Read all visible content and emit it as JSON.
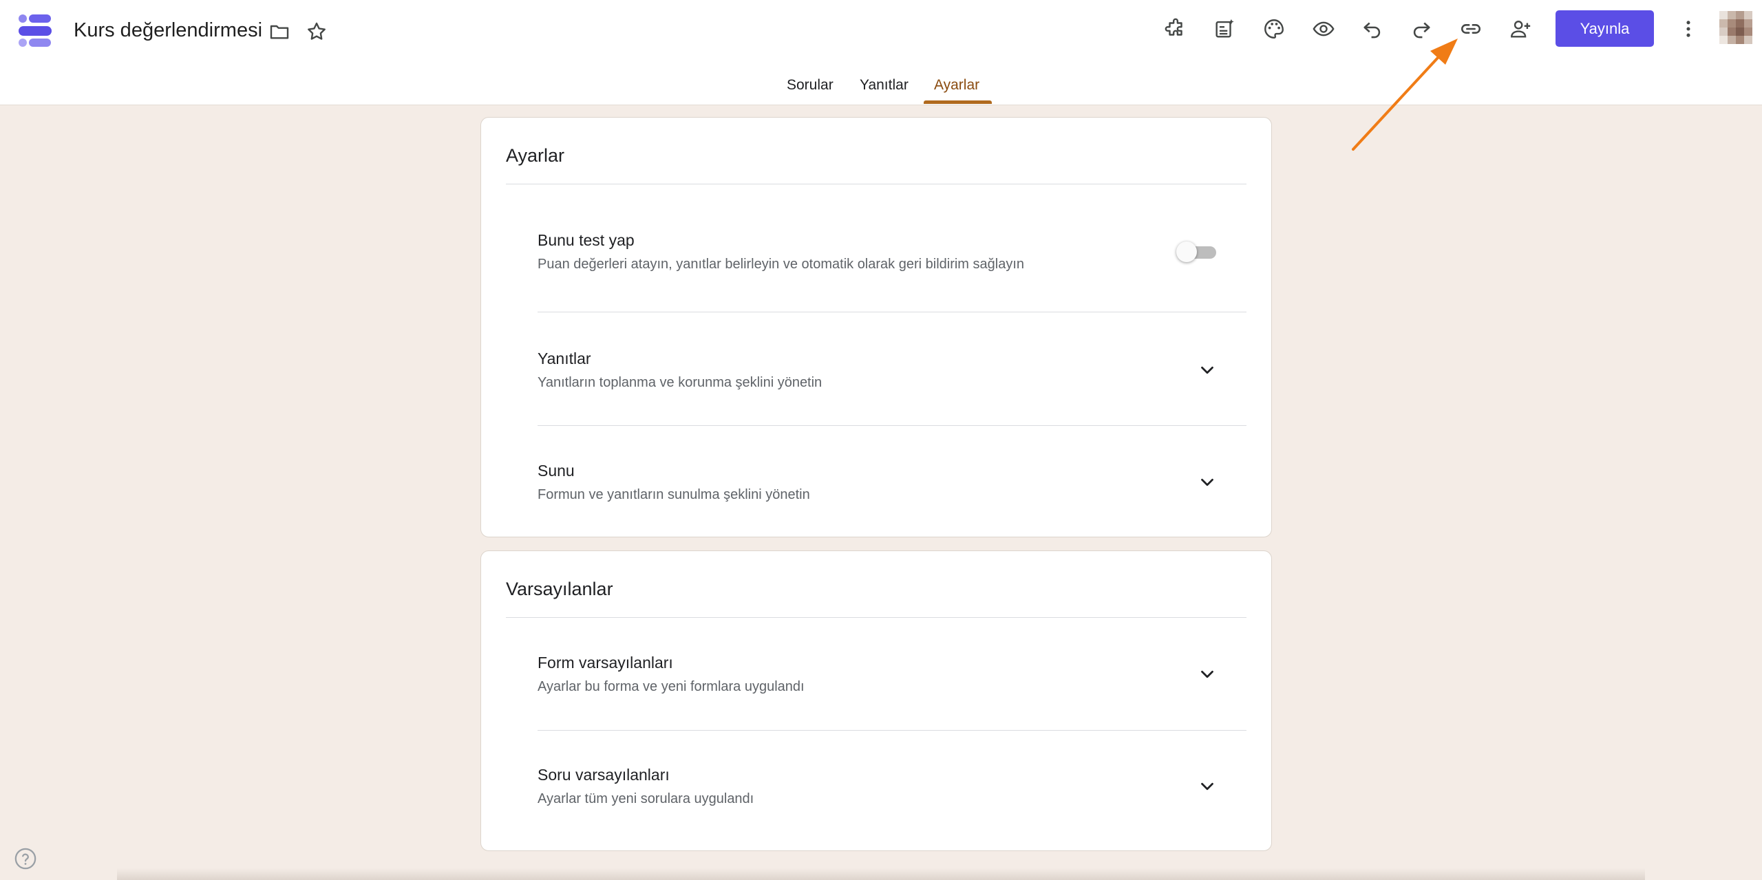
{
  "header": {
    "title": "Kurs değerlendirmesi",
    "publish_label": "Yayınla"
  },
  "tabs": [
    {
      "label": "Sorular"
    },
    {
      "label": "Yanıtlar"
    },
    {
      "label": "Ayarlar",
      "active": true
    }
  ],
  "settings_card": {
    "title": "Ayarlar",
    "rows": [
      {
        "title": "Bunu test yap",
        "subtitle": "Puan değerleri atayın, yanıtlar belirleyin ve otomatik olarak geri bildirim sağlayın",
        "control": "toggle",
        "toggle_on": false
      },
      {
        "title": "Yanıtlar",
        "subtitle": "Yanıtların toplanma ve korunma şeklini yönetin",
        "control": "chevron"
      },
      {
        "title": "Sunu",
        "subtitle": "Formun ve yanıtların sunulma şeklini yönetin",
        "control": "chevron"
      }
    ]
  },
  "defaults_card": {
    "title": "Varsayılanlar",
    "rows": [
      {
        "title": "Form varsayılanları",
        "subtitle": "Ayarlar bu forma ve yeni formlara uygulandı",
        "control": "chevron"
      },
      {
        "title": "Soru varsayılanları",
        "subtitle": "Ayarlar tüm yeni sorulara uygulandı",
        "control": "chevron"
      }
    ]
  },
  "icons": {
    "toolbar": [
      "addons-icon",
      "quiz-ai-icon",
      "palette-icon",
      "preview-icon",
      "undo-icon",
      "redo-icon",
      "link-icon",
      "add-collaborator-icon",
      "more-vert-icon"
    ]
  },
  "colors": {
    "accent": "#5b4ee6",
    "active_tab": "#8a4b0f",
    "background": "#f4ece6",
    "annotation_arrow": "#f07c16"
  }
}
